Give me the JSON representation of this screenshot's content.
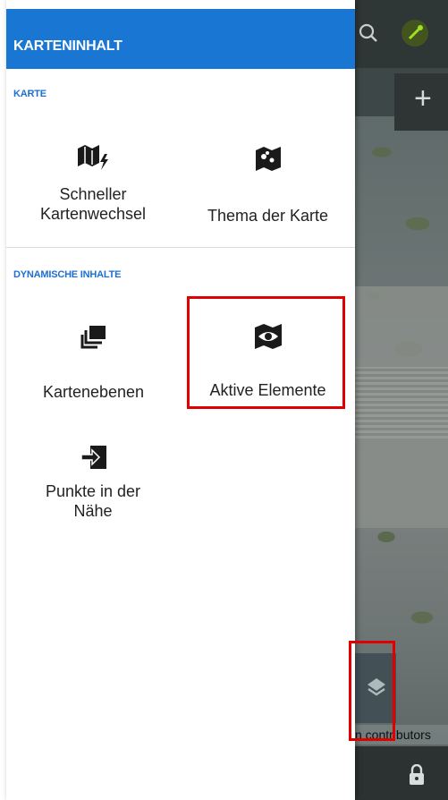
{
  "drawer": {
    "title": "KARTENINHALT",
    "sections": [
      {
        "label": "KARTE",
        "items": [
          {
            "label": "Schneller Kartenwechsel",
            "icon": "map-flash-icon"
          },
          {
            "label": "Thema der Karte",
            "icon": "map-theme-icon"
          }
        ]
      },
      {
        "label": "DYNAMISCHE INHALTE",
        "items": [
          {
            "label": "Kartenebenen",
            "icon": "layers-icon"
          },
          {
            "label": "Aktive Elemente",
            "icon": "map-eye-icon"
          },
          {
            "label": "Punkte in der Nähe",
            "icon": "enter-arrow-icon"
          }
        ]
      }
    ]
  },
  "map": {
    "attribution": "n contributors",
    "icons": [
      "search-icon",
      "gps-icon",
      "zoom-in-icon",
      "layers-icon",
      "lock-icon"
    ],
    "gps_color": "#9ee026"
  },
  "colors": {
    "header": "#1976d2",
    "section_label": "#1e6fd0",
    "highlight": "#e00000"
  }
}
